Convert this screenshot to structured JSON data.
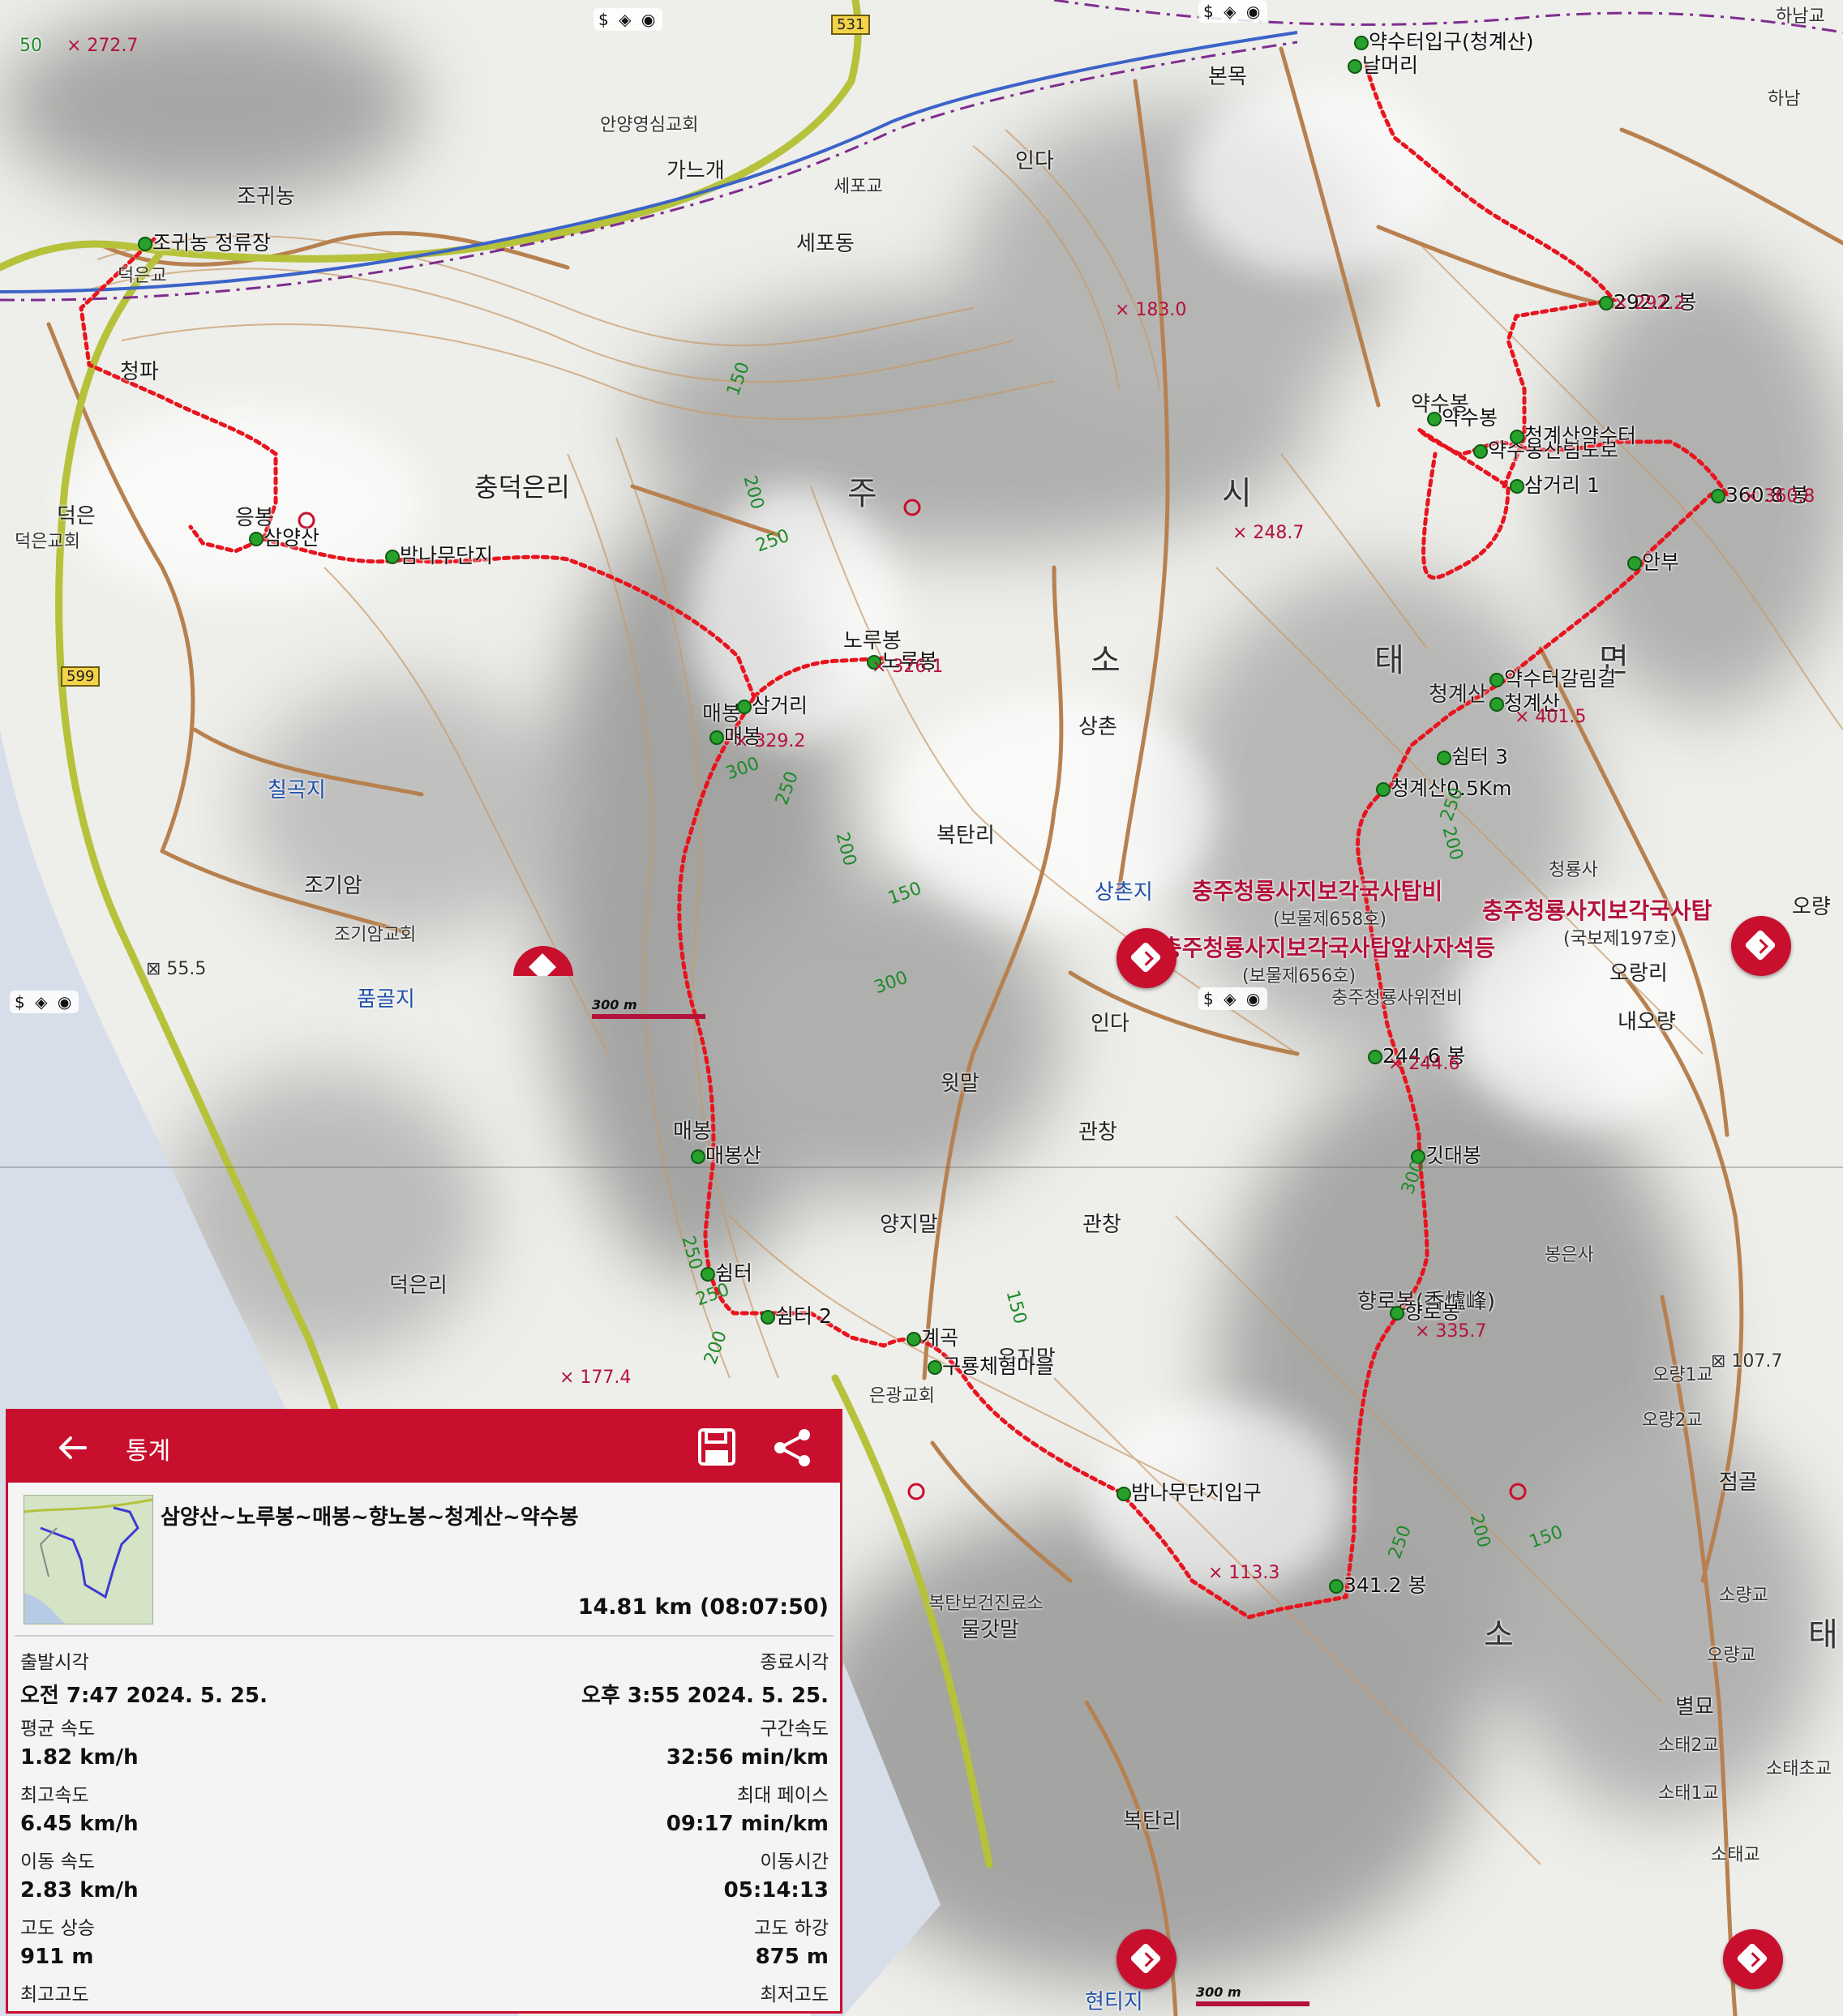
{
  "map": {
    "places": [
      {
        "id": "jogwinong",
        "text": "조귀농"
      },
      {
        "id": "gananggae",
        "text": "가느개"
      },
      {
        "id": "anyang-church",
        "text": "안양영심교회"
      },
      {
        "id": "sepogyo",
        "text": "세포교"
      },
      {
        "id": "sepodong",
        "text": "세포동"
      },
      {
        "id": "inda-top",
        "text": "인다"
      },
      {
        "id": "bonmok",
        "text": "본목"
      },
      {
        "id": "hanamgyo",
        "text": "하남교"
      },
      {
        "id": "hanam",
        "text": "하남"
      },
      {
        "id": "chungdeokeunri",
        "text": "충덕은리"
      },
      {
        "id": "cheongpa",
        "text": "청파"
      },
      {
        "id": "deogeun",
        "text": "덕은"
      },
      {
        "id": "deogeun-church",
        "text": "덕은교회"
      },
      {
        "id": "deogeungyo",
        "text": "덕은교"
      },
      {
        "id": "big-ju",
        "text": "주"
      },
      {
        "id": "big-si",
        "text": "시"
      },
      {
        "id": "big-so",
        "text": "소"
      },
      {
        "id": "big-tae",
        "text": "태"
      },
      {
        "id": "big-myeon",
        "text": "면"
      },
      {
        "id": "big-so2",
        "text": "소"
      },
      {
        "id": "big-tae2",
        "text": "태"
      },
      {
        "id": "sangchon",
        "text": "상촌"
      },
      {
        "id": "boktanri",
        "text": "복탄리"
      },
      {
        "id": "chilgokji",
        "text": "칠곡지"
      },
      {
        "id": "jogiam",
        "text": "조기암"
      },
      {
        "id": "jogiam-church",
        "text": "조기암교회"
      },
      {
        "id": "pumgolji",
        "text": "품골지"
      },
      {
        "id": "sangchonji",
        "text": "상촌지"
      },
      {
        "id": "inda-mid",
        "text": "인다"
      },
      {
        "id": "witmal",
        "text": "윗말"
      },
      {
        "id": "gwanchang",
        "text": "관창"
      },
      {
        "id": "gwanchang2",
        "text": "관창"
      },
      {
        "id": "yangjimal",
        "text": "양지말"
      },
      {
        "id": "eunjimal",
        "text": "은지말"
      },
      {
        "id": "eungwang-church",
        "text": "은광교회"
      },
      {
        "id": "deogeunri2",
        "text": "덕은리"
      },
      {
        "id": "boktan-clinic",
        "text": "복탄보건진료소"
      },
      {
        "id": "mulgatmal",
        "text": "물갓말"
      },
      {
        "id": "boktanri2",
        "text": "복탄리"
      },
      {
        "id": "oryangri",
        "text": "오랑리"
      },
      {
        "id": "naeoryang",
        "text": "내오량"
      },
      {
        "id": "oryang",
        "text": "오량"
      },
      {
        "id": "oryang1gyo",
        "text": "오량1교"
      },
      {
        "id": "oryang2gyo",
        "text": "오량2교"
      },
      {
        "id": "jeomgol",
        "text": "점골"
      },
      {
        "id": "soryanggyo",
        "text": "소량교"
      },
      {
        "id": "oryanggyo",
        "text": "오량교"
      },
      {
        "id": "byeolmyo",
        "text": "별묘"
      },
      {
        "id": "sotae2gyo",
        "text": "소태2교"
      },
      {
        "id": "sotae-school",
        "text": "소태초교"
      },
      {
        "id": "sotae1gyo",
        "text": "소태1교"
      },
      {
        "id": "sotaegyo",
        "text": "소태교"
      },
      {
        "id": "bongeunsa",
        "text": "봉은사"
      },
      {
        "id": "cheongryongsa",
        "text": "청룡사"
      },
      {
        "id": "hyeontiji",
        "text": "현티지"
      },
      {
        "id": "cheonggyesan-label",
        "text": "청계산"
      },
      {
        "id": "maebong-label",
        "text": "매봉"
      },
      {
        "id": "maebong-label2",
        "text": "매봉"
      },
      {
        "id": "norubong-label",
        "text": "노루봉"
      },
      {
        "id": "eungbong-label",
        "text": "응봉"
      },
      {
        "id": "yaksubong-label",
        "text": "약수봉"
      },
      {
        "id": "hyangrobong-label",
        "text": "향로봉(香爐峰)"
      },
      {
        "id": "grave-site",
        "text": "충주청룡사위전비"
      }
    ],
    "temples": [
      {
        "id": "t1",
        "text": "충주청룡사지보각국사탑비",
        "sub": "(보물제658호)"
      },
      {
        "id": "t2",
        "text": "충주청룡사지보각국사탑앞사자석등",
        "sub": "(보물제656호)"
      },
      {
        "id": "t3",
        "text": "충주청룡사지보각국사탑",
        "sub": "(국보제197호)"
      }
    ],
    "waypoints": [
      "조귀농 정류장",
      "삼양산",
      "밤나무단지",
      "삼거리",
      "노루봉",
      "매봉",
      "매봉산",
      "쉼터",
      "쉼터 2",
      "계곡",
      "구룡체험마을",
      "밤나무단지입구",
      "341.2 봉",
      "향로봉",
      "깃대봉",
      "244.6 봉",
      "청계산0.5Km",
      "쉼터 3",
      "청계산",
      "약수터갈림길",
      "안부",
      "360.8 봉",
      "삼거리 1",
      "약수봉산림도로",
      "청계산약수터",
      "약수봉",
      "292.2 봉",
      "날머리",
      "약수터입구(청계산)"
    ],
    "elevations": [
      "272.7",
      "183.0",
      "248.7",
      "326.1",
      "329.2",
      "401.5",
      "244.6",
      "335.7",
      "177.4",
      "292.2",
      "360.8",
      "113.3"
    ],
    "benchmarks": [
      "55.5",
      "107.7"
    ],
    "contours": [
      "150",
      "200",
      "250",
      "250",
      "200",
      "300",
      "250",
      "200",
      "150",
      "300",
      "250",
      "250",
      "200",
      "150",
      "300",
      "250",
      "200",
      "150"
    ],
    "road_shields": [
      "531",
      "599"
    ],
    "scale": "300 m",
    "poi_badge": "$ ◈ ◉",
    "grid_marks": [
      "50"
    ]
  },
  "stats": {
    "title": "통계",
    "track_name": "삼양산~노루봉~매봉~향노봉~청계산~약수봉",
    "distance": "14.81 km (08:07:50)",
    "rows": [
      {
        "left_label": "출발시각",
        "left_value": "오전 7:47 2024. 5. 25.",
        "right_label": "종료시각",
        "right_value": "오후 3:55 2024. 5. 25."
      },
      {
        "left_label": "평균 속도",
        "left_value": "1.82 km/h",
        "right_label": "구간속도",
        "right_value": "32:56 min/km"
      },
      {
        "left_label": "최고속도",
        "left_value": "6.45 km/h",
        "right_label": "최대 페이스",
        "right_value": "09:17 min/km"
      },
      {
        "left_label": "이동 속도",
        "left_value": "2.83 km/h",
        "right_label": "이동시간",
        "right_value": "05:14:13"
      },
      {
        "left_label": "고도 상승",
        "left_value": "911 m",
        "right_label": "고도 하강",
        "right_value": "875 m"
      },
      {
        "left_label": "최고고도",
        "left_value": "",
        "right_label": "최저고도",
        "right_value": ""
      }
    ]
  },
  "colors": {
    "accent": "#c8102e",
    "route": "#e8141e",
    "contour": "#c79a66",
    "road_main": "#b5c23a",
    "river": "#5e8ee0"
  }
}
